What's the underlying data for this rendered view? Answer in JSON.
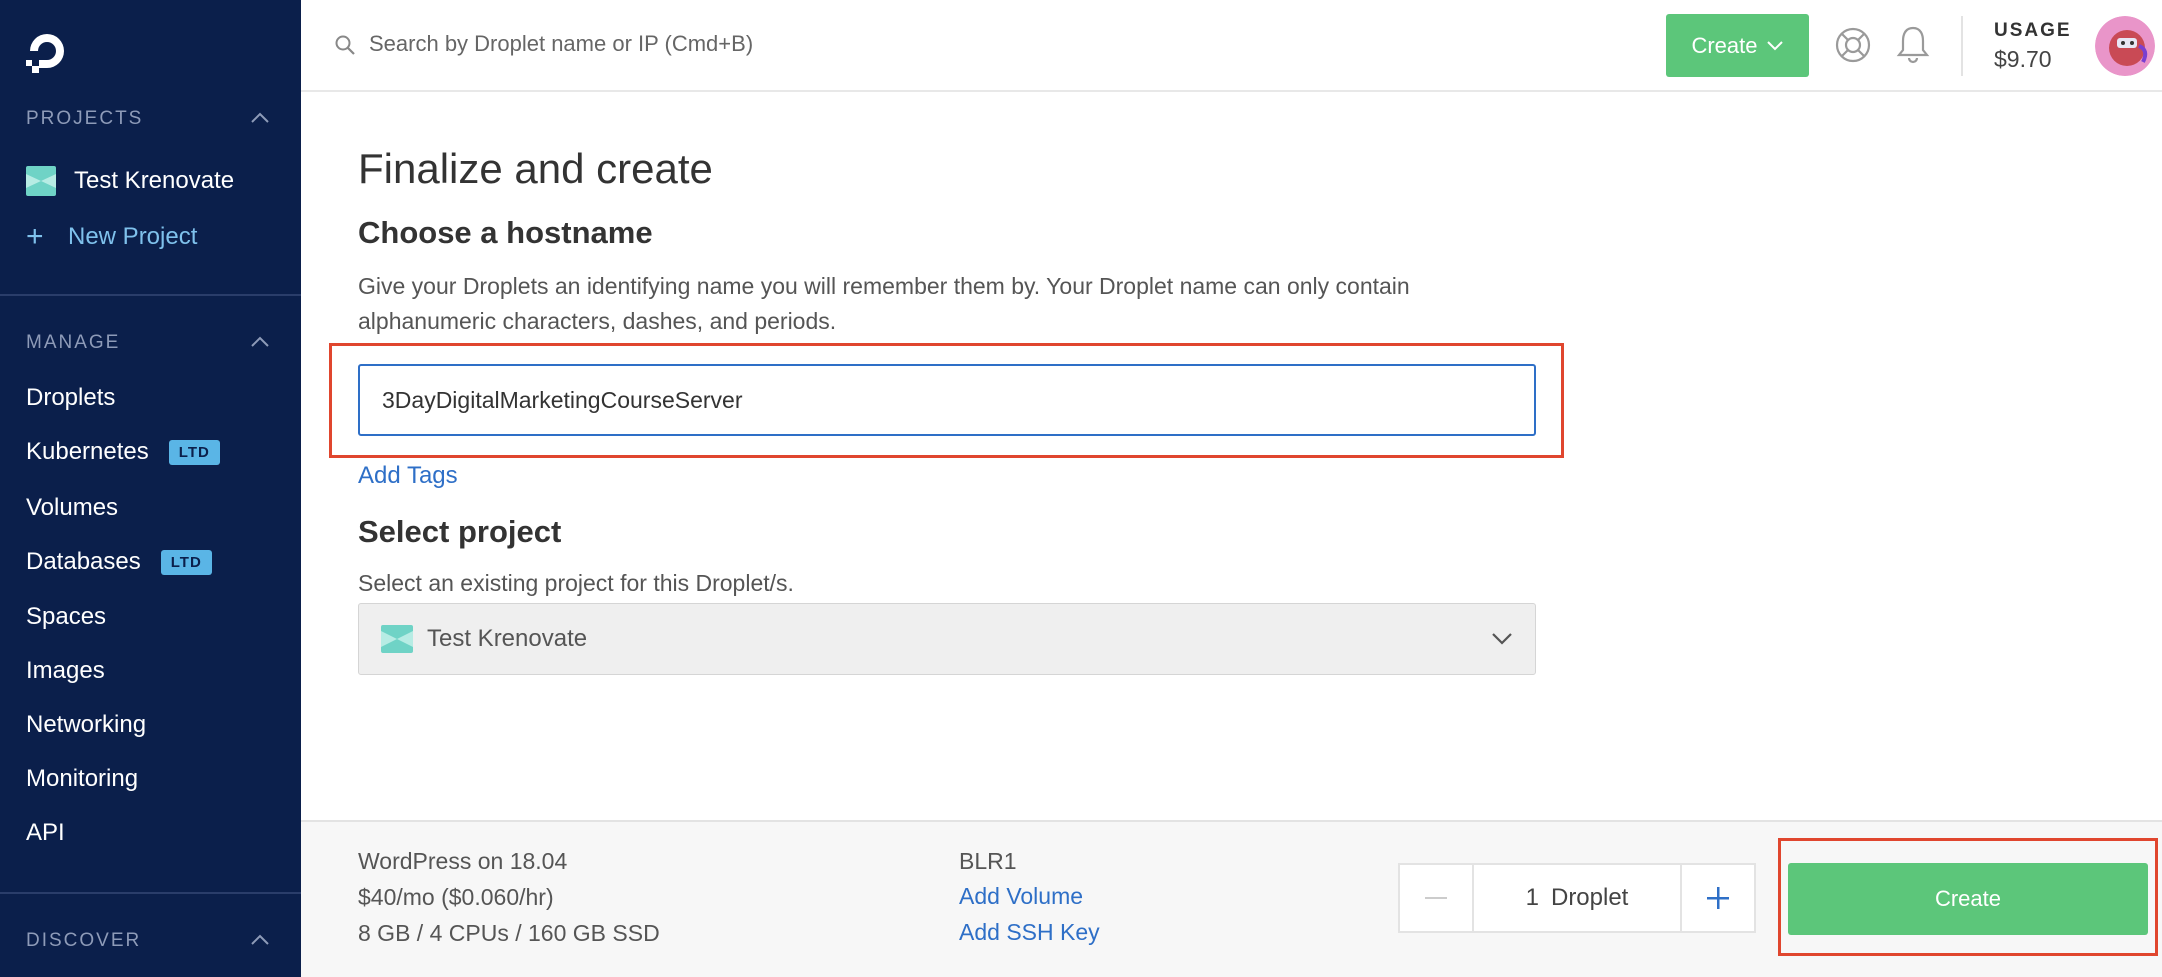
{
  "sidebar": {
    "projects_heading": "PROJECTS",
    "project_name": "Test Krenovate",
    "new_project": "New Project",
    "manage_heading": "MANAGE",
    "nav": [
      {
        "label": "Droplets",
        "badge": ""
      },
      {
        "label": "Kubernetes",
        "badge": "LTD"
      },
      {
        "label": "Volumes",
        "badge": ""
      },
      {
        "label": "Databases",
        "badge": "LTD"
      },
      {
        "label": "Spaces",
        "badge": ""
      },
      {
        "label": "Images",
        "badge": ""
      },
      {
        "label": "Networking",
        "badge": ""
      },
      {
        "label": "Monitoring",
        "badge": ""
      },
      {
        "label": "API",
        "badge": ""
      }
    ],
    "discover_heading": "DISCOVER"
  },
  "topbar": {
    "search_placeholder": "Search by Droplet name or IP (Cmd+B)",
    "create_label": "Create",
    "usage_label": "USAGE",
    "usage_value": "$9.70"
  },
  "main": {
    "title": "Finalize and create",
    "hostname_heading": "Choose a hostname",
    "hostname_desc": "Give your Droplets an identifying name you will remember them by. Your Droplet name can only contain alphanumeric characters, dashes, and periods.",
    "hostname_value": "3DayDigitalMarketingCourseServer",
    "add_tags": "Add Tags",
    "project_heading": "Select project",
    "project_desc": "Select an existing project for this Droplet/s.",
    "project_selected": "Test Krenovate"
  },
  "footer": {
    "image": "WordPress on 18.04",
    "price": "$40/mo ($0.060/hr)",
    "specs": "8 GB / 4 CPUs / 160 GB SSD",
    "region": "BLR1",
    "add_volume": "Add Volume",
    "add_ssh": "Add SSH Key",
    "count": "1",
    "count_unit": "Droplet",
    "create_label": "Create"
  },
  "colors": {
    "sidebar_bg": "#0b1f4b",
    "accent_green": "#5cc67a",
    "link_blue": "#2e6fc7",
    "highlight_red": "#e0462e"
  }
}
